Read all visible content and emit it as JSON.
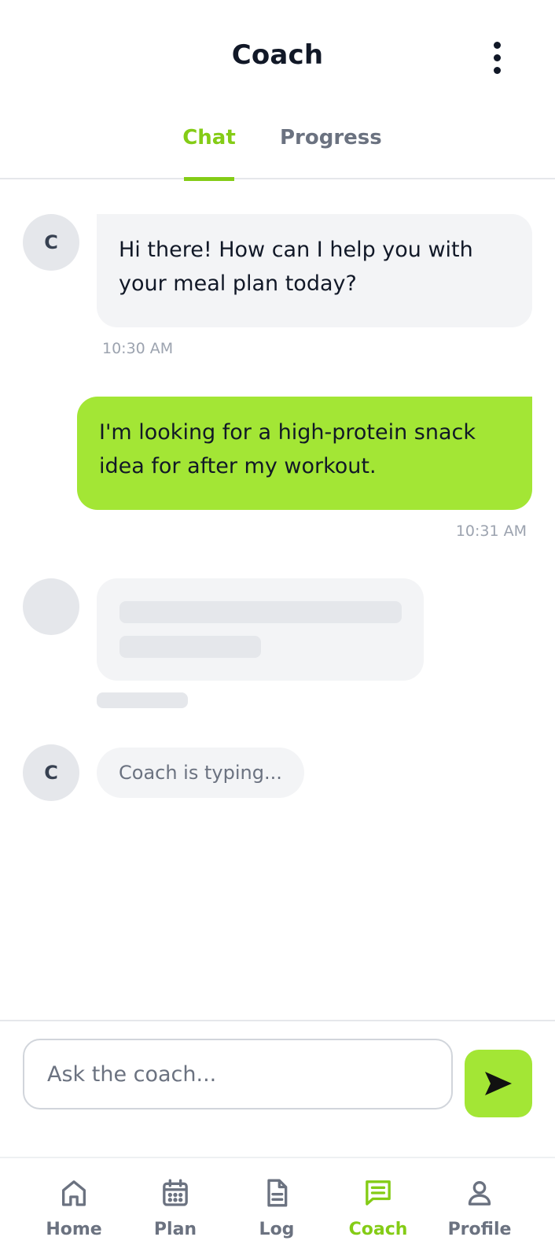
{
  "header": {
    "title": "Coach",
    "more_icon": "more-vertical-icon"
  },
  "tabs": [
    {
      "label": "Chat",
      "active": true
    },
    {
      "label": "Progress",
      "active": false
    }
  ],
  "messages": [
    {
      "sender": "coach",
      "avatar_initial": "C",
      "text": "Hi there! How can I help you with your meal plan today?",
      "time": "10:30 AM"
    },
    {
      "sender": "user",
      "text": "I'm looking for a high-protein snack idea for after my workout.",
      "time": "10:31 AM"
    }
  ],
  "typing": {
    "avatar_initial": "C",
    "text": "Coach is typing..."
  },
  "composer": {
    "placeholder": "Ask the coach...",
    "value": "",
    "send_icon": "send-icon"
  },
  "nav": [
    {
      "label": "Home",
      "icon": "home-icon",
      "active": false
    },
    {
      "label": "Plan",
      "icon": "calendar-icon",
      "active": false
    },
    {
      "label": "Log",
      "icon": "document-icon",
      "active": false
    },
    {
      "label": "Coach",
      "icon": "chat-icon",
      "active": true
    },
    {
      "label": "Profile",
      "icon": "user-icon",
      "active": false
    }
  ],
  "colors": {
    "accent": "#84cc16",
    "user_bubble": "#a3e635",
    "coach_bubble": "#f3f4f6",
    "muted": "#6b7280"
  }
}
